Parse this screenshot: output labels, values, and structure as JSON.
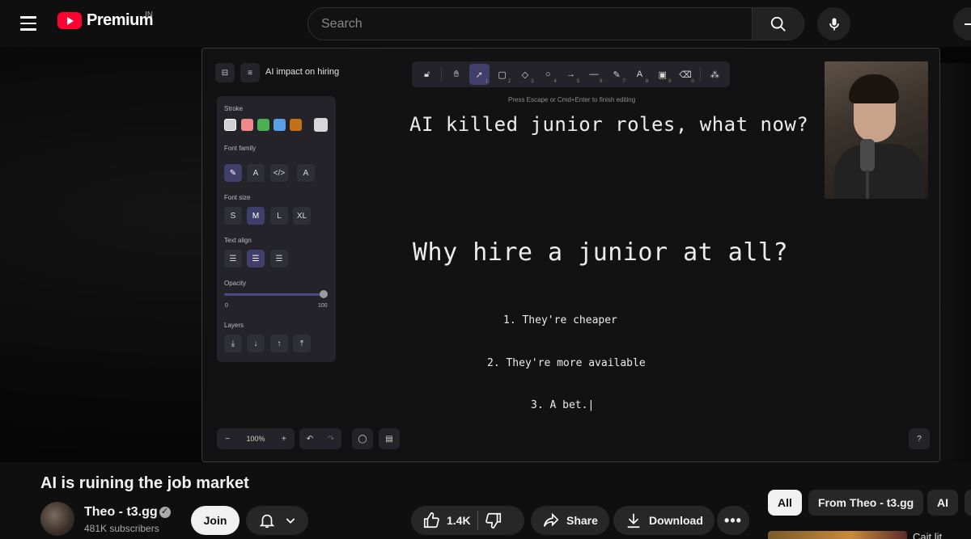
{
  "header": {
    "brand": "Premium",
    "country": "IN",
    "search_placeholder": "Search",
    "icons": {
      "menu": "hamburger-menu-icon",
      "search": "search-icon",
      "mic": "microphone-icon",
      "create": "create-icon"
    }
  },
  "canvas": {
    "doc_title": "AI impact on hiring",
    "hint": "Press Escape or Cmd+Enter to finish editing",
    "panel": {
      "stroke_label": "Stroke",
      "stroke_colors": [
        "#d0d0d0",
        "#ef8a8a",
        "#4caf50",
        "#5aa0e6",
        "#c4701a",
        "#d7d7d7"
      ],
      "font_family_label": "Font family",
      "font_size_label": "Font size",
      "font_sizes": [
        "S",
        "M",
        "L",
        "XL"
      ],
      "text_align_label": "Text align",
      "opacity_label": "Opacity",
      "opacity_min": "0",
      "opacity_max": "100",
      "opacity_value": 100,
      "layers_label": "Layers"
    },
    "heading": "AI killed junior roles, what now?",
    "subheading": "Why hire a junior at all?",
    "list_items": [
      "1. They're cheaper",
      "2. They're more available",
      "3. A bet.|"
    ],
    "zoom": "100%",
    "tools": [
      "lock",
      "hand",
      "selection",
      "rectangle",
      "diamond",
      "ellipse",
      "arrow",
      "line",
      "draw",
      "text",
      "image",
      "eraser",
      "library"
    ]
  },
  "video": {
    "title": "AI is ruining the job market",
    "channel": "Theo - t3.gg",
    "subscribers": "481K subscribers",
    "join_label": "Join",
    "like_count": "1.4K",
    "share_label": "Share",
    "download_label": "Download"
  },
  "chips": [
    "All",
    "From Theo - t3.gg",
    "AI"
  ],
  "recommendation_title": "Cait lit..."
}
